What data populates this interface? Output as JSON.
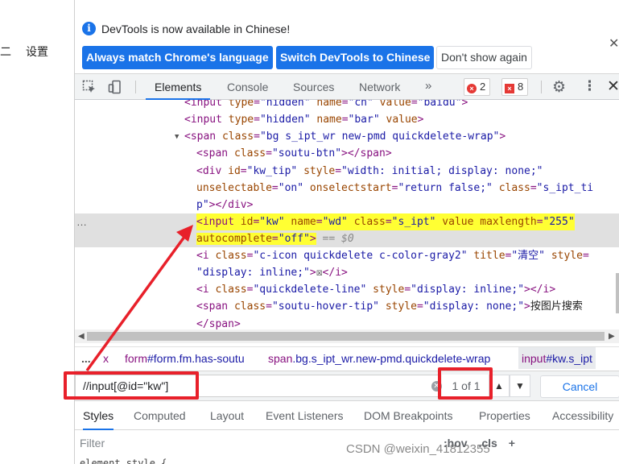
{
  "page": {
    "left_glyph": "二",
    "settings_label": "设置"
  },
  "infobar": {
    "message": "DevTools is now available in Chinese!",
    "btn_match": "Always match Chrome's language",
    "btn_switch": "Switch DevTools to Chinese",
    "btn_dismiss": "Don't show again"
  },
  "toolbar": {
    "tabs": [
      "Elements",
      "Console",
      "Sources",
      "Network"
    ],
    "more": "»",
    "errors_count": "2",
    "warnings_count": "8",
    "error_glyph": "×",
    "close": "✕"
  },
  "dom": {
    "l0": {
      "tag_open": "<input ",
      "a1": "type",
      "v1": "\"hidden\"",
      "a2": "name",
      "v2": "\"ch\"",
      "a3": "value",
      "v3": "\"baidu\"",
      "close": ">"
    },
    "l1": {
      "tag_open": "<input ",
      "a1": "type",
      "v1": "\"hidden\"",
      "a2": "name",
      "v2": "\"bar\"",
      "a3": "value",
      "close": ">"
    },
    "l2": {
      "tag_open": "<span ",
      "a1": "class",
      "v1": "\"bg s_ipt_wr new-pmd quickdelete-wrap\"",
      "close": ">"
    },
    "l3": {
      "tag_open": "<span ",
      "a1": "class",
      "v1": "\"soutu-btn\"",
      "close": "></span>"
    },
    "l4": {
      "tag_open": "<div ",
      "a1": "id",
      "v1": "\"kw_tip\"",
      "a2": "style",
      "v2": "\"width: initial; display: none;\""
    },
    "l5": {
      "a1": "unselectable",
      "v1": "\"on\"",
      "a2": "onselectstart",
      "v2": "\"return false;\"",
      "a3": "class",
      "v3": "\"s_ipt_ti"
    },
    "l6": {
      "v1": "p\"",
      "close": "></div>"
    },
    "l7": {
      "tag_open": "<input ",
      "a1": "id",
      "v1": "\"kw\"",
      "a2": "name",
      "v2": "\"wd\"",
      "a3": "class",
      "v3": "\"s_ipt\"",
      "a4": "value maxlength",
      "v4": "\"255\""
    },
    "l8": {
      "a1": "autocomplete",
      "v1": "\"off\"",
      "close": ">",
      "eq": " == $0"
    },
    "l9": {
      "tag_open": "<i ",
      "a1": "class",
      "v1": "\"c-icon quickdelete c-color-gray2\"",
      "a2": "title",
      "v2": "\"清空\"",
      "a3": "style"
    },
    "l10": {
      "v1": "\"display: inline;\"",
      "close": ">",
      "text": "☒",
      "end": "</i>"
    },
    "l11": {
      "tag_open": "<i ",
      "a1": "class",
      "v1": "\"quickdelete-line\"",
      "a2": "style",
      "v2": "\"display: inline;\"",
      "close": "></i>"
    },
    "l12": {
      "tag_open": "<span ",
      "a1": "class",
      "v1": "\"soutu-hover-tip\"",
      "a2": "style",
      "v2": "\"display: none;\"",
      "close": ">",
      "text": "按图片搜索"
    },
    "l13": {
      "close": "</span>"
    },
    "ellipsis": "…"
  },
  "breadcrumbs": {
    "dots": "...",
    "items": [
      {
        "tag": "x",
        "cls": ""
      },
      {
        "tag": "form",
        "cls": "#form.fm.has-soutu"
      },
      {
        "tag": "span",
        "cls": ".bg.s_ipt_wr.new-pmd.quickdelete-wrap"
      },
      {
        "tag": "input",
        "cls": "#kw.s_ipt"
      }
    ]
  },
  "search": {
    "query": "//input[@id=\"kw\"]",
    "match_count": "1 of 1",
    "cancel_label": "Cancel"
  },
  "styles_tabs": [
    "Styles",
    "Computed",
    "Layout",
    "Event Listeners",
    "DOM Breakpoints",
    "Properties",
    "Accessibility"
  ],
  "filter": {
    "placeholder": "Filter",
    "hov": ":hov",
    "cls": ".cls",
    "plus": "+"
  },
  "rule_peek": "element.style {",
  "watermark": "CSDN @weixin_41812355",
  "colors": {
    "accent": "#1a73e8",
    "annotation": "#e8202a",
    "highlight": "#ffff33",
    "tag": "#881280",
    "attr": "#994500",
    "value": "#1a1aa6"
  }
}
